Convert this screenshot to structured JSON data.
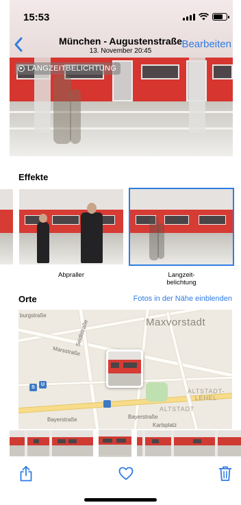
{
  "status_bar": {
    "time": "15:53"
  },
  "nav": {
    "title": "München - Augustenstraße",
    "subtitle": "13. November  20:45",
    "edit_label": "Bearbeiten"
  },
  "photo": {
    "badge_label": "LANGZEITBELICHTUNG"
  },
  "effects": {
    "heading": "Effekte",
    "items": [
      {
        "label": "Abpraller"
      },
      {
        "label_line1": "Langzeit-",
        "label_line2": "belichtung"
      }
    ]
  },
  "places": {
    "heading": "Orte",
    "nearby_link": "Fotos in der Nähe einblenden",
    "map": {
      "district": "Maxvorstadt",
      "district_altstadt_lehel_1": "ALTSTADT-",
      "district_altstadt_lehel_2": "LEHEL",
      "district_altstadt": "ALTSTADT",
      "street_burgstrasse": "burgstraße",
      "street_marsstrasse": "Marsstraße",
      "street_seidlstrasse": "Seidlstraße",
      "street_bayerstrasse_left": "Bayerstraße",
      "street_bayerstrasse_right": "Bayerstraße",
      "place_karlsplatz": "Karlsplatz",
      "transit_s": "S",
      "transit_u": "U"
    }
  },
  "colors": {
    "accent": "#2f7ce3",
    "train_red": "#d63b34"
  },
  "toolbar": {
    "share_icon": "share-icon",
    "favorite_icon": "heart-icon",
    "delete_icon": "trash-icon"
  }
}
